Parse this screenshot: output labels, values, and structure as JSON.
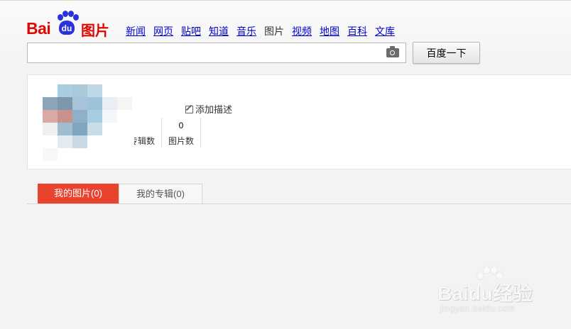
{
  "logo": {
    "bai": "Bai",
    "du": "du",
    "tupian": "图片"
  },
  "nav": [
    {
      "label": "新闻",
      "current": false
    },
    {
      "label": "网页",
      "current": false
    },
    {
      "label": "贴吧",
      "current": false
    },
    {
      "label": "知道",
      "current": false
    },
    {
      "label": "音乐",
      "current": false
    },
    {
      "label": "图片",
      "current": true
    },
    {
      "label": "视频",
      "current": false
    },
    {
      "label": "地图",
      "current": false
    },
    {
      "label": "百科",
      "current": false
    },
    {
      "label": "文库",
      "current": false
    }
  ],
  "search": {
    "value": "",
    "placeholder": "",
    "button_label": "百度一下",
    "camera_icon": "camera-icon"
  },
  "profile": {
    "description_link": "添加描述",
    "edit_icon": "edit-icon",
    "stats": [
      {
        "value": "",
        "label": "专辑数"
      },
      {
        "value": "0",
        "label": "图片数"
      }
    ]
  },
  "tabs": [
    {
      "label": "我的图片(0)",
      "active": true
    },
    {
      "label": "我的专辑(0)",
      "active": false
    }
  ],
  "watermark": {
    "main": "Baidu经验",
    "url": "jingyan.baidu.com"
  },
  "colors": {
    "brand_red": "#e10602",
    "brand_blue": "#2932e1",
    "tab_active": "#e9432e",
    "link": "#0000cc"
  }
}
